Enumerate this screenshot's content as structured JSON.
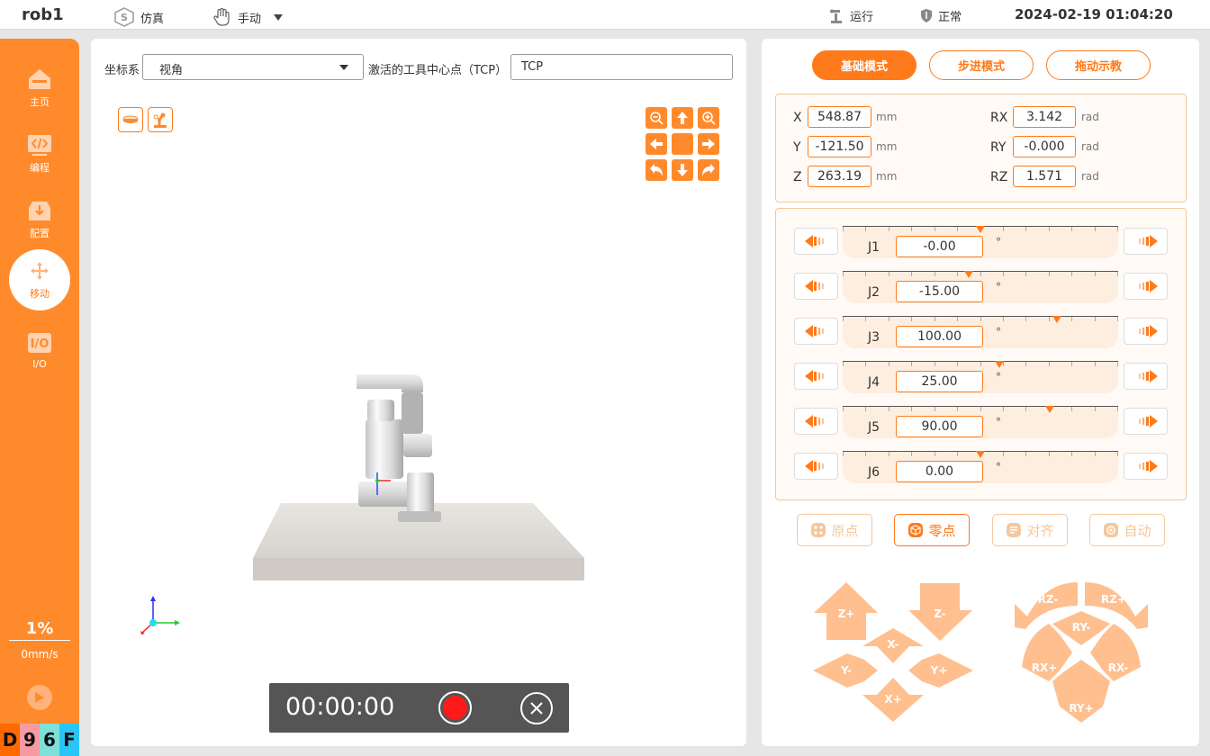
{
  "header": {
    "robot_name": "rob1",
    "mode_sim": "仿真",
    "mode_manual": "手动",
    "status_run": "运行",
    "status_normal": "正常",
    "datetime": "2024-02-19 01:04:20"
  },
  "sidebar": {
    "items": [
      {
        "label": "主页",
        "icon": "home-icon"
      },
      {
        "label": "编程",
        "icon": "code-icon"
      },
      {
        "label": "配置",
        "icon": "config-icon"
      },
      {
        "label": "移动",
        "icon": "move-icon"
      },
      {
        "label": "I/O",
        "icon": "io-icon"
      }
    ],
    "speed_percent": "1%",
    "speed_value": "0mm/s",
    "code_chars": [
      "D",
      "9",
      "6",
      "F"
    ],
    "code_colors": [
      "#ff6a00",
      "#f59aa0",
      "#7ee0d8",
      "#29c5f6"
    ]
  },
  "viewer": {
    "coord_label": "坐标系",
    "coord_value": "视角",
    "tcp_label": "激活的工具中心点（TCP）",
    "tcp_value": "TCP",
    "record_time": "00:00:00"
  },
  "control": {
    "modes": [
      "基础模式",
      "步进模式",
      "拖动示教"
    ],
    "cartesian": [
      {
        "axis": "X",
        "value": "548.87",
        "unit": "mm"
      },
      {
        "axis": "Y",
        "value": "-121.50",
        "unit": "mm"
      },
      {
        "axis": "Z",
        "value": "263.19",
        "unit": "mm"
      },
      {
        "axis": "RX",
        "value": "3.142",
        "unit": "rad"
      },
      {
        "axis": "RY",
        "value": "-0.000",
        "unit": "rad"
      },
      {
        "axis": "RZ",
        "value": "1.571",
        "unit": "rad"
      }
    ],
    "joints": [
      {
        "name": "J1",
        "value": "-0.00",
        "unit": "°",
        "level": 0.5
      },
      {
        "name": "J2",
        "value": "-15.00",
        "unit": "°",
        "level": 0.458
      },
      {
        "name": "J3",
        "value": "100.00",
        "unit": "°",
        "level": 0.778
      },
      {
        "name": "J4",
        "value": "25.00",
        "unit": "°",
        "level": 0.569
      },
      {
        "name": "J5",
        "value": "90.00",
        "unit": "°",
        "level": 0.75
      },
      {
        "name": "J6",
        "value": "0.00",
        "unit": "°",
        "level": 0.5
      }
    ],
    "actions": [
      "原点",
      "零点",
      "对齐",
      "自动"
    ],
    "linear_pad": [
      "Z+",
      "Z-",
      "X-",
      "Y-",
      "Y+",
      "X+"
    ],
    "rotary_pad": [
      "RZ-",
      "RZ+",
      "RY-",
      "RX+",
      "RX-",
      "RY+"
    ],
    "accent": "#ff7a1a"
  }
}
